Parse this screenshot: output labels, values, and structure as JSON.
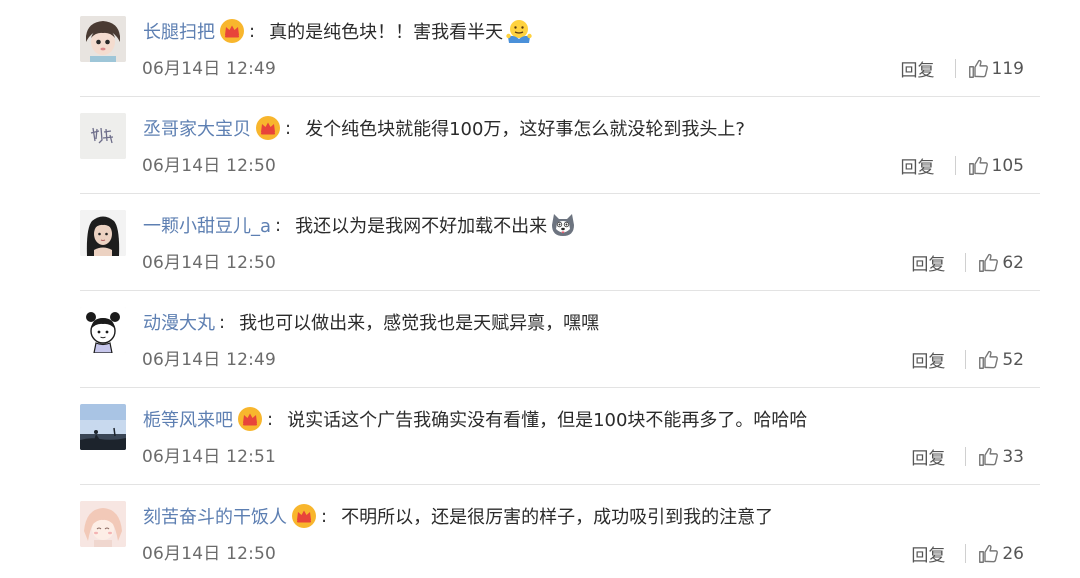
{
  "comments": [
    {
      "username": "长腿扫把",
      "vip": true,
      "content": "真的是纯色块！！害我看半天",
      "emoji": "shrug-emoji",
      "time": "06月14日 12:49",
      "reply_label": "回复",
      "likes": "119"
    },
    {
      "username": "丞哥家大宝贝",
      "vip": true,
      "content": "发个纯色块就能得100万，这好事怎么就没轮到我头上?",
      "emoji": null,
      "time": "06月14日 12:50",
      "reply_label": "回复",
      "likes": "105"
    },
    {
      "username": "一颗小甜豆儿_a",
      "vip": false,
      "content": "我还以为是我网不好加载不出来",
      "emoji": "husky-emoji",
      "time": "06月14日 12:50",
      "reply_label": "回复",
      "likes": "62"
    },
    {
      "username": "动漫大丸",
      "vip": false,
      "content": "我也可以做出来，感觉我也是天赋异禀，嘿嘿",
      "emoji": null,
      "time": "06月14日 12:49",
      "reply_label": "回复",
      "likes": "52"
    },
    {
      "username": "栀等风来吧",
      "vip": true,
      "content": "说实话这个广告我确实没有看懂，但是100块不能再多了。哈哈哈",
      "emoji": null,
      "time": "06月14日 12:51",
      "reply_label": "回复",
      "likes": "33"
    },
    {
      "username": "刻苦奋斗的干饭人",
      "vip": true,
      "content": "不明所以，还是很厉害的样子，成功吸引到我的注意了",
      "emoji": null,
      "time": "06月14日 12:50",
      "reply_label": "回复",
      "likes": "26"
    }
  ],
  "colors": {
    "username": "#5d7fb2",
    "divider": "#e3e3e3",
    "crown": "#f5a623"
  }
}
